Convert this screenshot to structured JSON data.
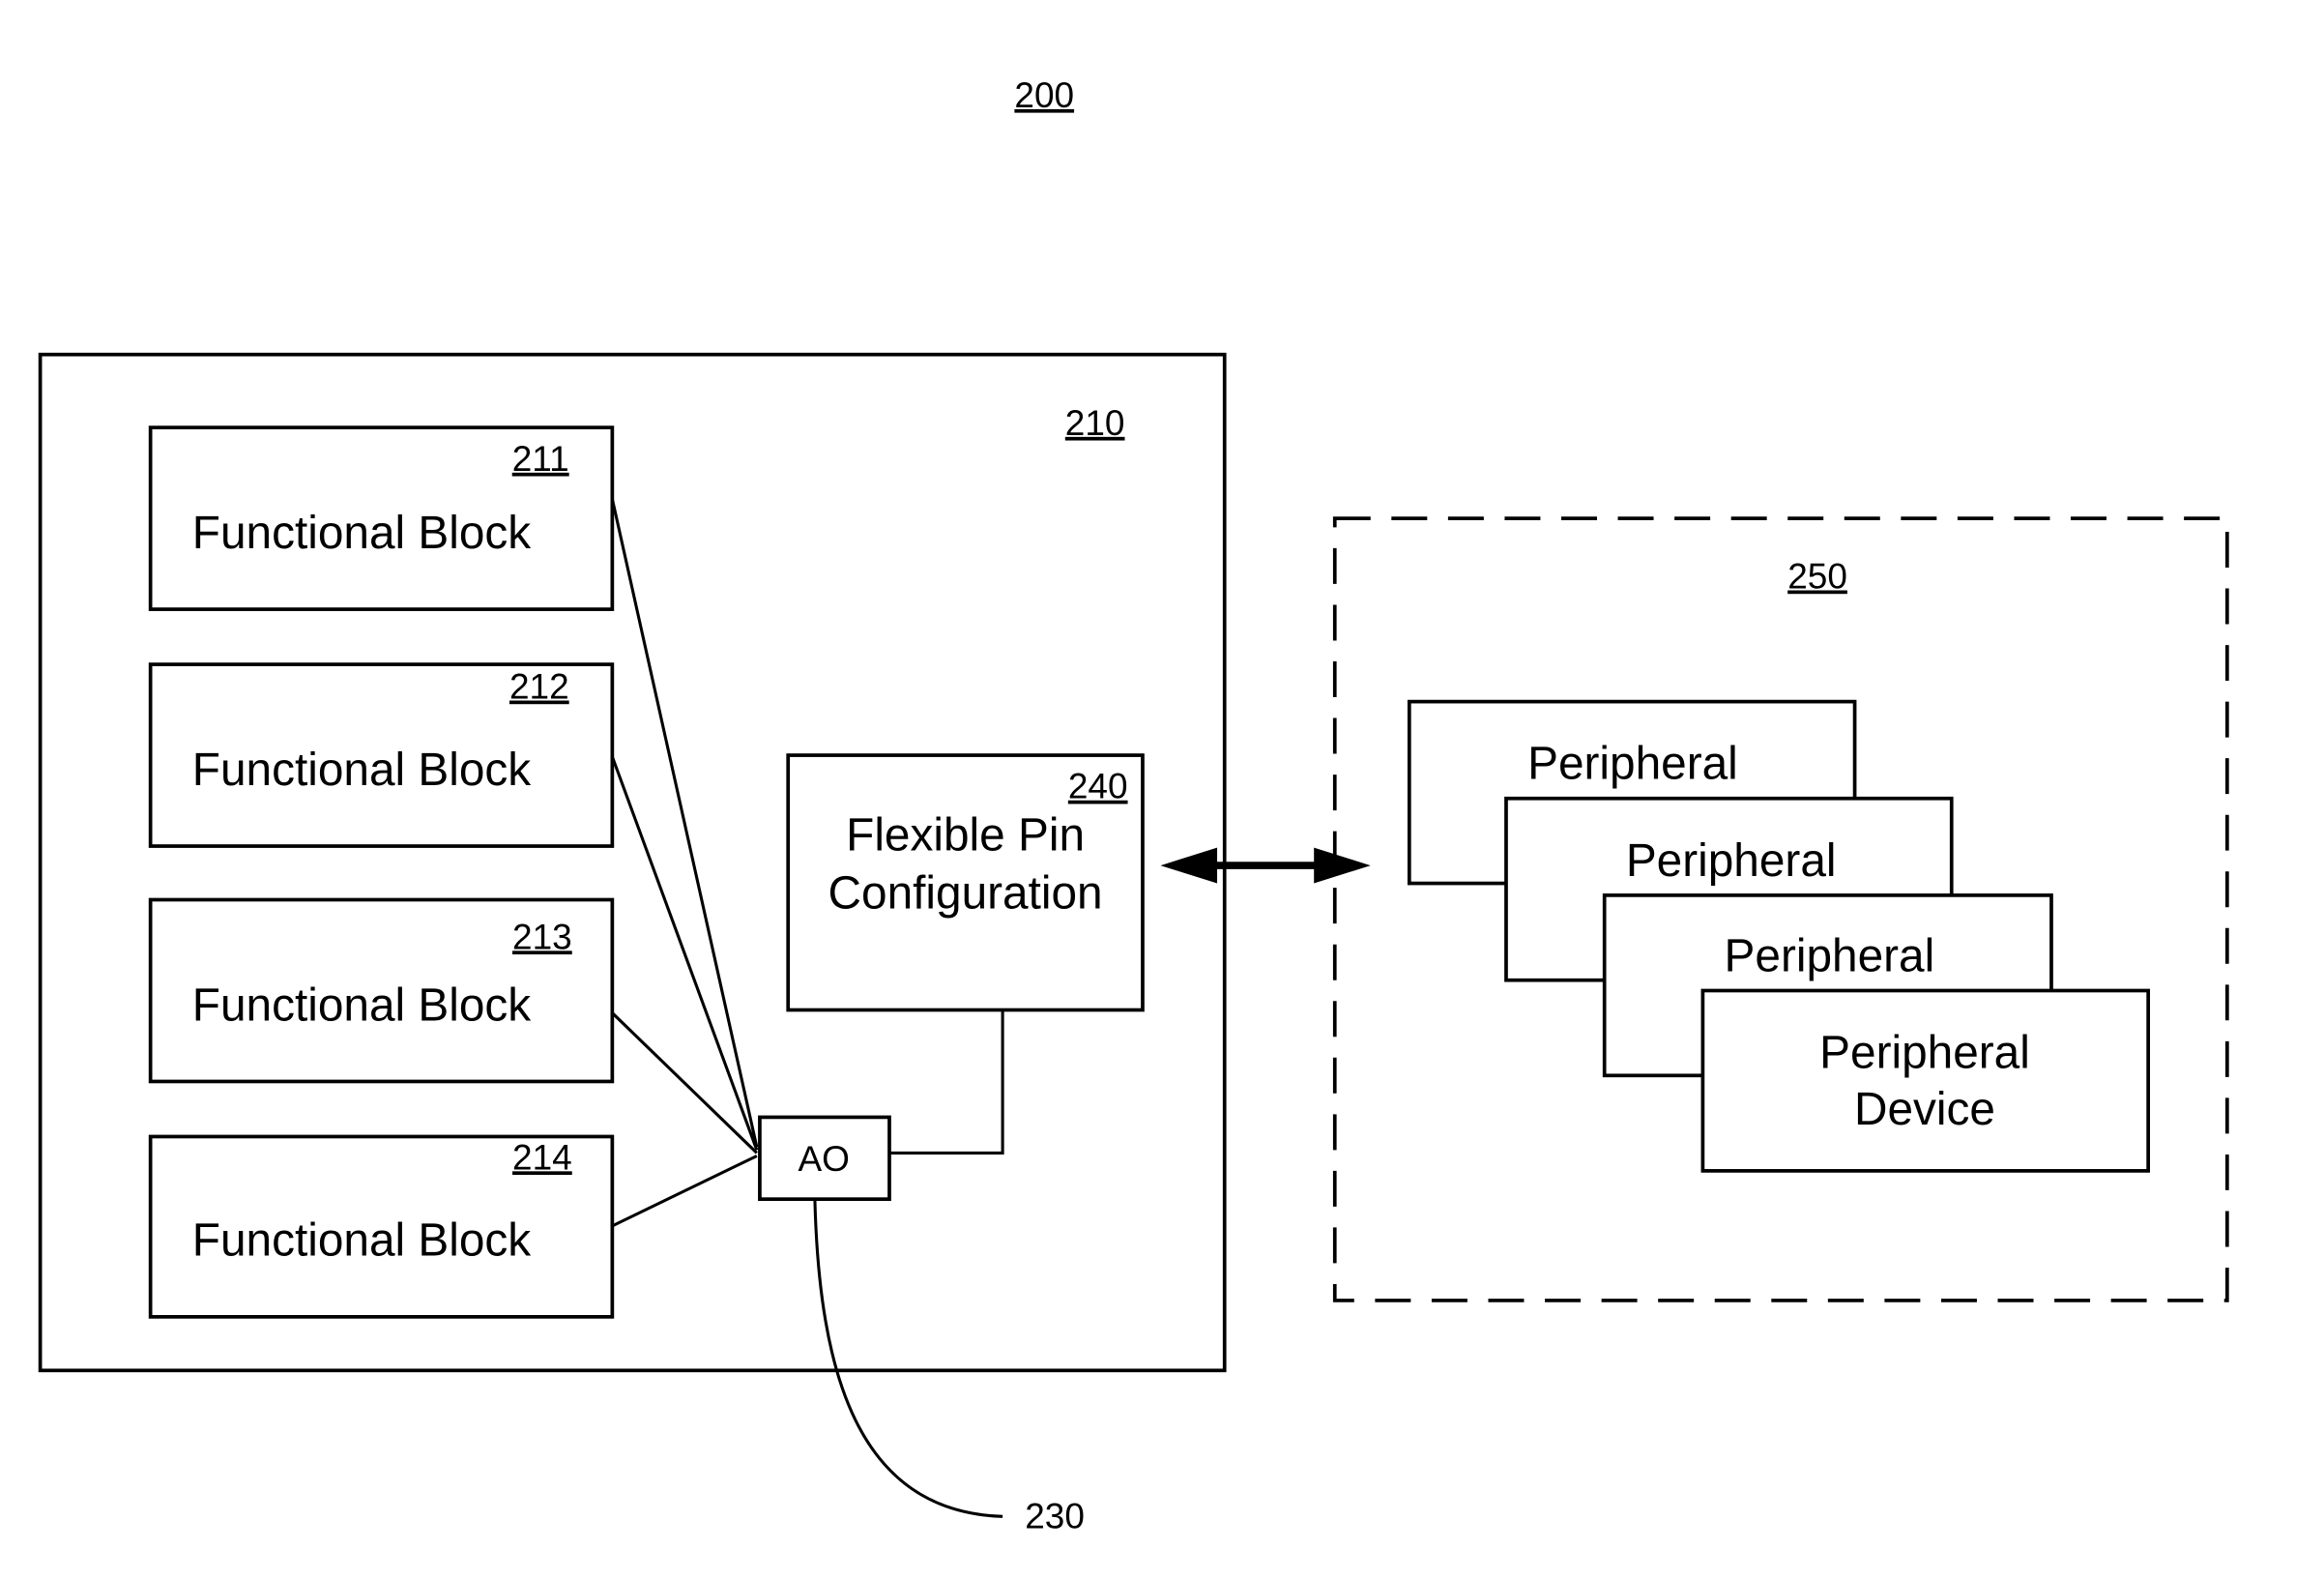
{
  "figure": {
    "ref": "200",
    "colors": {
      "stroke": "#000000",
      "background": "#ffffff"
    }
  },
  "device": {
    "ref": "210",
    "functional_blocks": [
      {
        "ref": "211",
        "label": "Functional Block"
      },
      {
        "ref": "212",
        "label": "Functional Block"
      },
      {
        "ref": "213",
        "label": "Functional Block"
      },
      {
        "ref": "214",
        "label": "Functional Block"
      }
    ],
    "ao": {
      "label": "AO"
    },
    "flex_pin": {
      "ref": "240",
      "line1": "Flexible Pin",
      "line2": "Configuration"
    },
    "connector_ref": "230"
  },
  "peripherals": {
    "ref": "250",
    "cards": [
      {
        "label": "Peripheral"
      },
      {
        "label": "Peripheral"
      },
      {
        "label": "Peripheral"
      },
      {
        "line1": "Peripheral",
        "line2": "Device"
      }
    ]
  },
  "link": {
    "type": "bidirectional-arrow"
  }
}
